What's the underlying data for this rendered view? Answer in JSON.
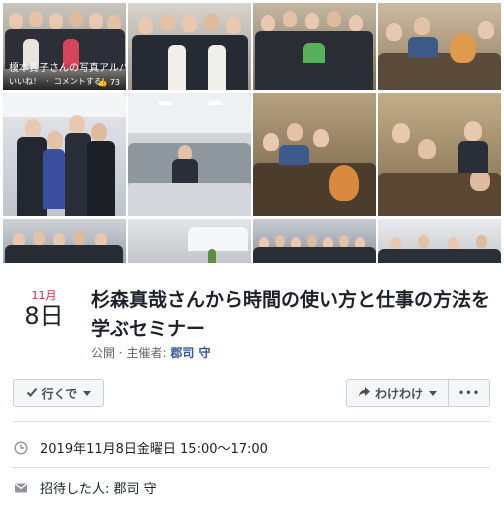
{
  "album": {
    "title": "榎本貴子さんの写真アルバム",
    "like_label": "いいね！",
    "comment_label": "コメントする",
    "like_count": "73"
  },
  "event": {
    "month": "11月",
    "day": "8日",
    "title": "杉森真哉さんから時間の使い方と仕事の方法を学ぶセミナー",
    "meta_prefix": "公開 · 主催者: ",
    "host": "郡司 守"
  },
  "buttons": {
    "going": "行くで",
    "share": "わけわけ",
    "more": "•••"
  },
  "details": {
    "datetime": "2019年11月8日金曜日 15:00〜17:00",
    "invited_by": "招待した人: 郡司 守"
  },
  "icons": {
    "check": "check-icon",
    "share": "share-arrow-icon",
    "clock": "clock-icon",
    "mail": "envelope-icon"
  },
  "colors": {
    "accent_red": "#e41e3f",
    "link_blue": "#385898",
    "button_bg": "#f5f6f7",
    "border": "#ccd0d5"
  }
}
